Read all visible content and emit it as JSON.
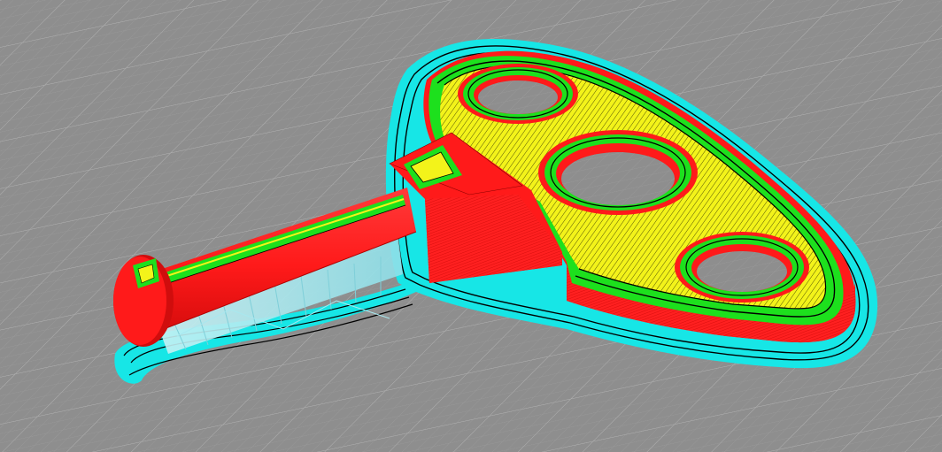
{
  "viewport": {
    "view": "layer-preview-3d",
    "background_color": "#8e8e8e",
    "grid": {
      "visible": true,
      "major_color": "#a9a9a9",
      "minor_color": "#9b9b9b"
    }
  },
  "model": {
    "object": "wind-up-key",
    "features": {
      "hole_count": 3,
      "has_shaft": true,
      "has_shaft_support": true,
      "has_skirt": true
    },
    "line_types": [
      {
        "role": "outer-wall",
        "color": "#ff1a1a"
      },
      {
        "role": "inner-wall",
        "color": "#1de01d"
      },
      {
        "role": "top-solid-infill",
        "color": "#f3f31a"
      },
      {
        "role": "skirt",
        "color": "#17e6e6"
      },
      {
        "role": "support",
        "color": "#9be3ec"
      },
      {
        "role": "line-separator",
        "color": "#000000"
      }
    ]
  }
}
